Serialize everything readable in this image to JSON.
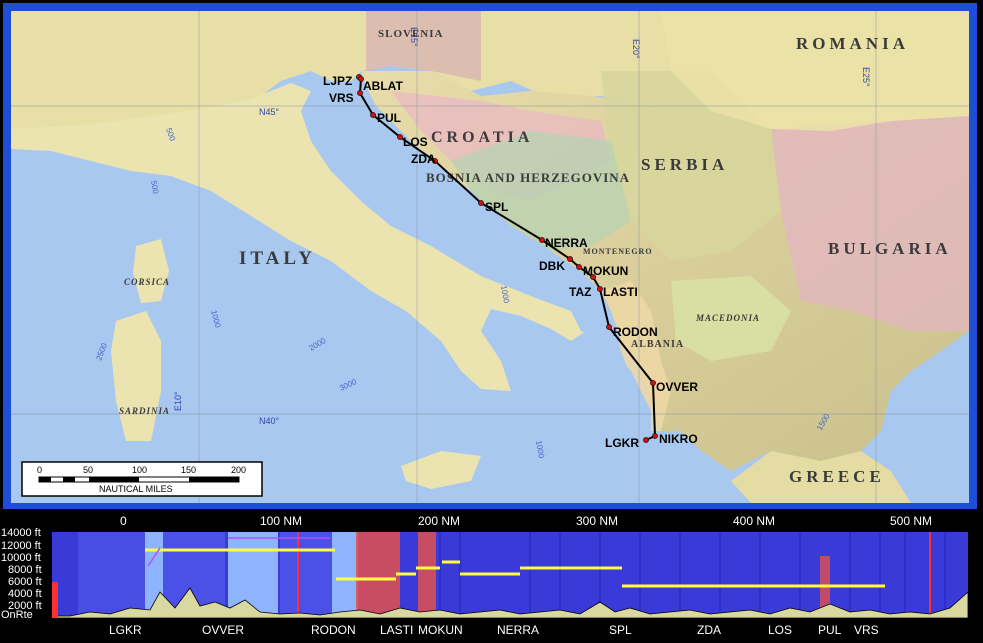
{
  "map": {
    "countries": {
      "romania": "ROMANIA",
      "slovenia": "SLOVENIA",
      "croatia": "CROATIA",
      "serbia": "SERBIA",
      "bosnia": "BOSNIA AND HERZEGOVINA",
      "montenegro": "MONTENEGRO",
      "bulgaria": "BULGARIA",
      "italy": "ITALY",
      "macedonia": "MACEDONIA",
      "albania": "ALBANIA",
      "greece": "GREECE",
      "corsica": "CORSICA",
      "sardinia": "SARDINIA"
    },
    "grid_labels": {
      "e15": "E15°",
      "e20": "E20°",
      "e25": "E25°",
      "e10": "E10°",
      "n45": "N45°",
      "n40": "N40°"
    },
    "depth_labels": [
      "500",
      "1000",
      "2000",
      "3000",
      "2500",
      "1000",
      "500",
      "1000",
      "1500"
    ],
    "waypoints": [
      {
        "name": "LJPZ"
      },
      {
        "name": "ABLAT"
      },
      {
        "name": "VRS"
      },
      {
        "name": "PUL"
      },
      {
        "name": "LOS"
      },
      {
        "name": "ZDA"
      },
      {
        "name": "SPL"
      },
      {
        "name": "NERRA"
      },
      {
        "name": "DBK"
      },
      {
        "name": "MOKUN"
      },
      {
        "name": "TAZ"
      },
      {
        "name": "LASTI"
      },
      {
        "name": "RODON"
      },
      {
        "name": "OVVER"
      },
      {
        "name": "LGKR"
      },
      {
        "name": "NIKRO"
      }
    ],
    "scale_bar": {
      "ticks": [
        "0",
        "50",
        "100",
        "150",
        "200"
      ],
      "unit": "NAUTICAL MILES"
    },
    "colors": {
      "sea": "#a9c8ef",
      "route": "#000000",
      "waypoint": "#d01010"
    }
  },
  "profile": {
    "distance_ticks": [
      "0",
      "100 NM",
      "200 NM",
      "300 NM",
      "400 NM",
      "500 NM"
    ],
    "altitude_ticks": [
      "14000 ft",
      "12000 ft",
      "10000 ft",
      "8000 ft",
      "6000 ft",
      "4000 ft",
      "2000 ft"
    ],
    "onrte_label": "OnRte",
    "waypoints": [
      "LGKR",
      "OVVER",
      "RODON",
      "LASTI",
      "MOKUN",
      "NERRA",
      "SPL",
      "ZDA",
      "LOS",
      "PUL",
      "VRS"
    ],
    "colors": {
      "background": "#3a3ad8",
      "airspace": "#ffff40",
      "terrain": "#d8d8a0",
      "restricted": "#e05050"
    }
  }
}
